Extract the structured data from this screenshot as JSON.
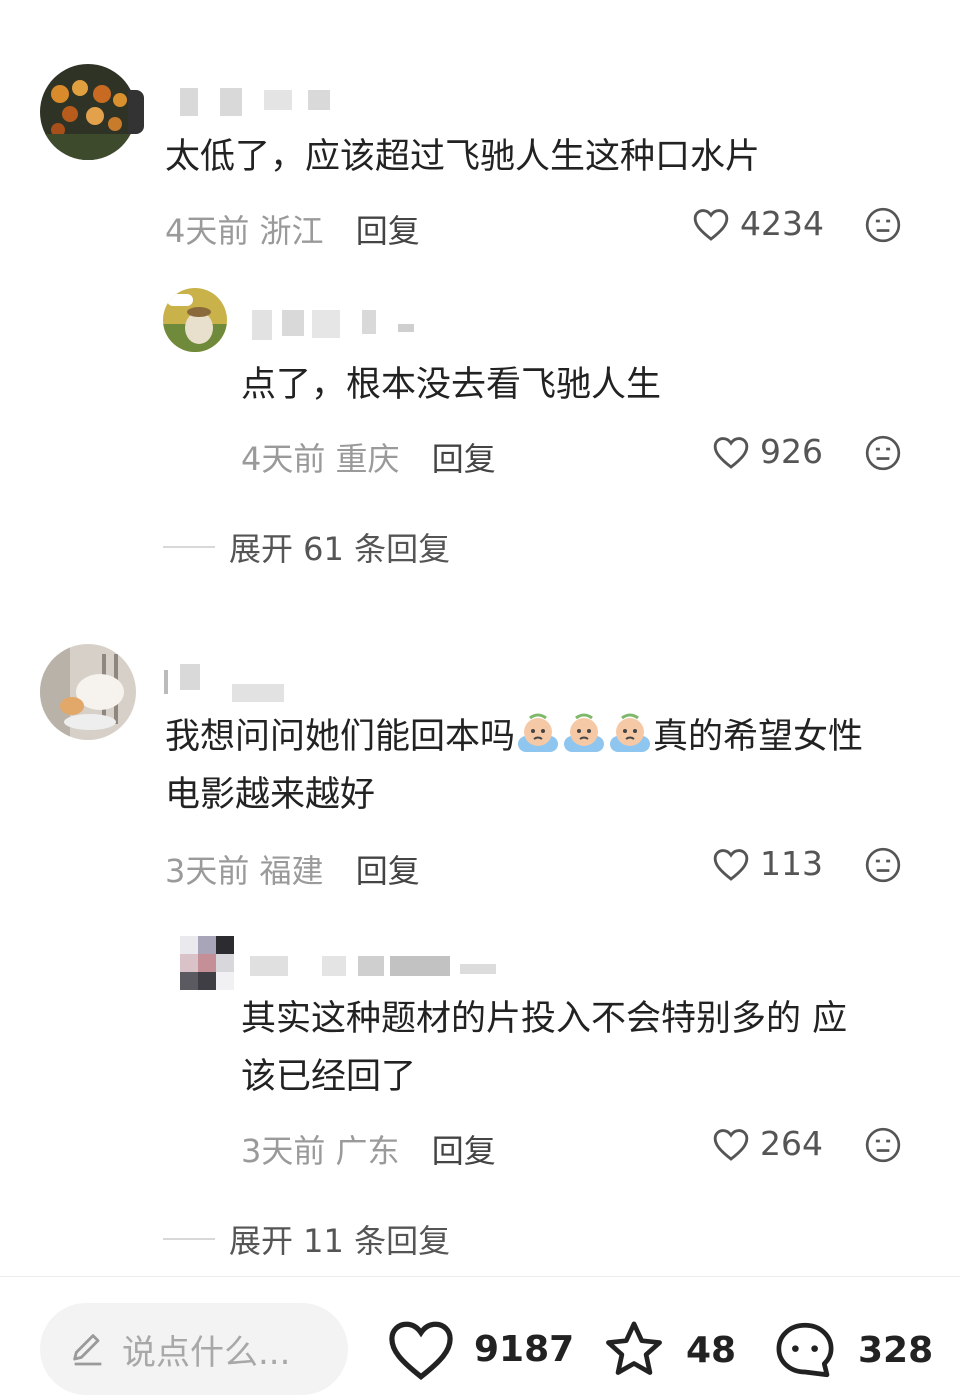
{
  "comments": [
    {
      "text": "太低了，应该超过飞驰人生这种口水片",
      "time": "4天前",
      "region": "浙江",
      "reply_label": "回复",
      "likes": "4234",
      "sub_reply": {
        "text": "点了，根本没去看飞驰人生",
        "time": "4天前",
        "region": "重庆",
        "reply_label": "回复",
        "likes": "926"
      },
      "expand_label": "展开 61 条回复"
    },
    {
      "text_before": "我想问问她们能回本吗",
      "text_after": "真的希望女性",
      "text_line2": "电影越来越好",
      "emoji_icon": "crying-emoji-icon",
      "emoji_count": 3,
      "time": "3天前",
      "region": "福建",
      "reply_label": "回复",
      "likes": "113",
      "sub_reply": {
        "text_line1": "其实这种题材的片投入不会特别多的 应",
        "text_line2": "该已经回了",
        "time": "3天前",
        "region": "广东",
        "reply_label": "回复",
        "likes": "264"
      },
      "expand_label": "展开 11 条回复"
    }
  ],
  "bottom_bar": {
    "input_placeholder": "说点什么...",
    "like_count": "9187",
    "star_count": "48",
    "comment_count": "328"
  },
  "colors": {
    "text": "#222222",
    "meta": "#9a9a9a",
    "icon": "#555555",
    "input_bg": "#f3f3f3"
  }
}
